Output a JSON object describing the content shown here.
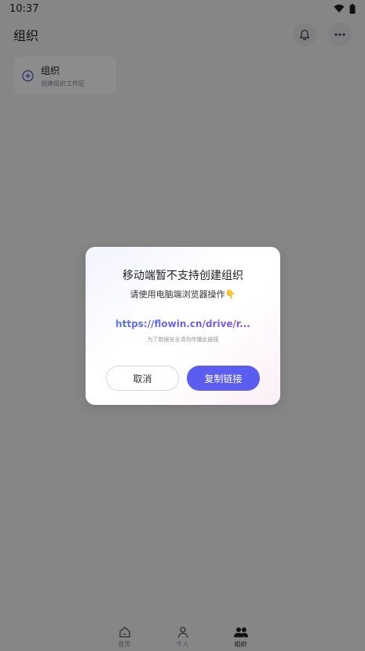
{
  "status_bar": {
    "time": "10:37"
  },
  "header": {
    "title": "组织"
  },
  "org_card": {
    "title": "组织",
    "subtitle": "创建组织工作区"
  },
  "tabs": [
    {
      "label": "首页",
      "icon": "home-icon"
    },
    {
      "label": "个人",
      "icon": "person-icon"
    },
    {
      "label": "组织",
      "icon": "group-icon",
      "active": true
    }
  ],
  "dialog": {
    "title": "移动端暂不支持创建组织",
    "subtitle": "请使用电脑端浏览器操作👇",
    "link": "https://flowin.cn/drive/r...",
    "note": "为了数据安全请勿传播此链接",
    "cancel_label": "取消",
    "copy_label": "复制链接"
  },
  "colors": {
    "accent": "#5a5df0",
    "overlay": "rgba(0,0,0,0.45)"
  }
}
